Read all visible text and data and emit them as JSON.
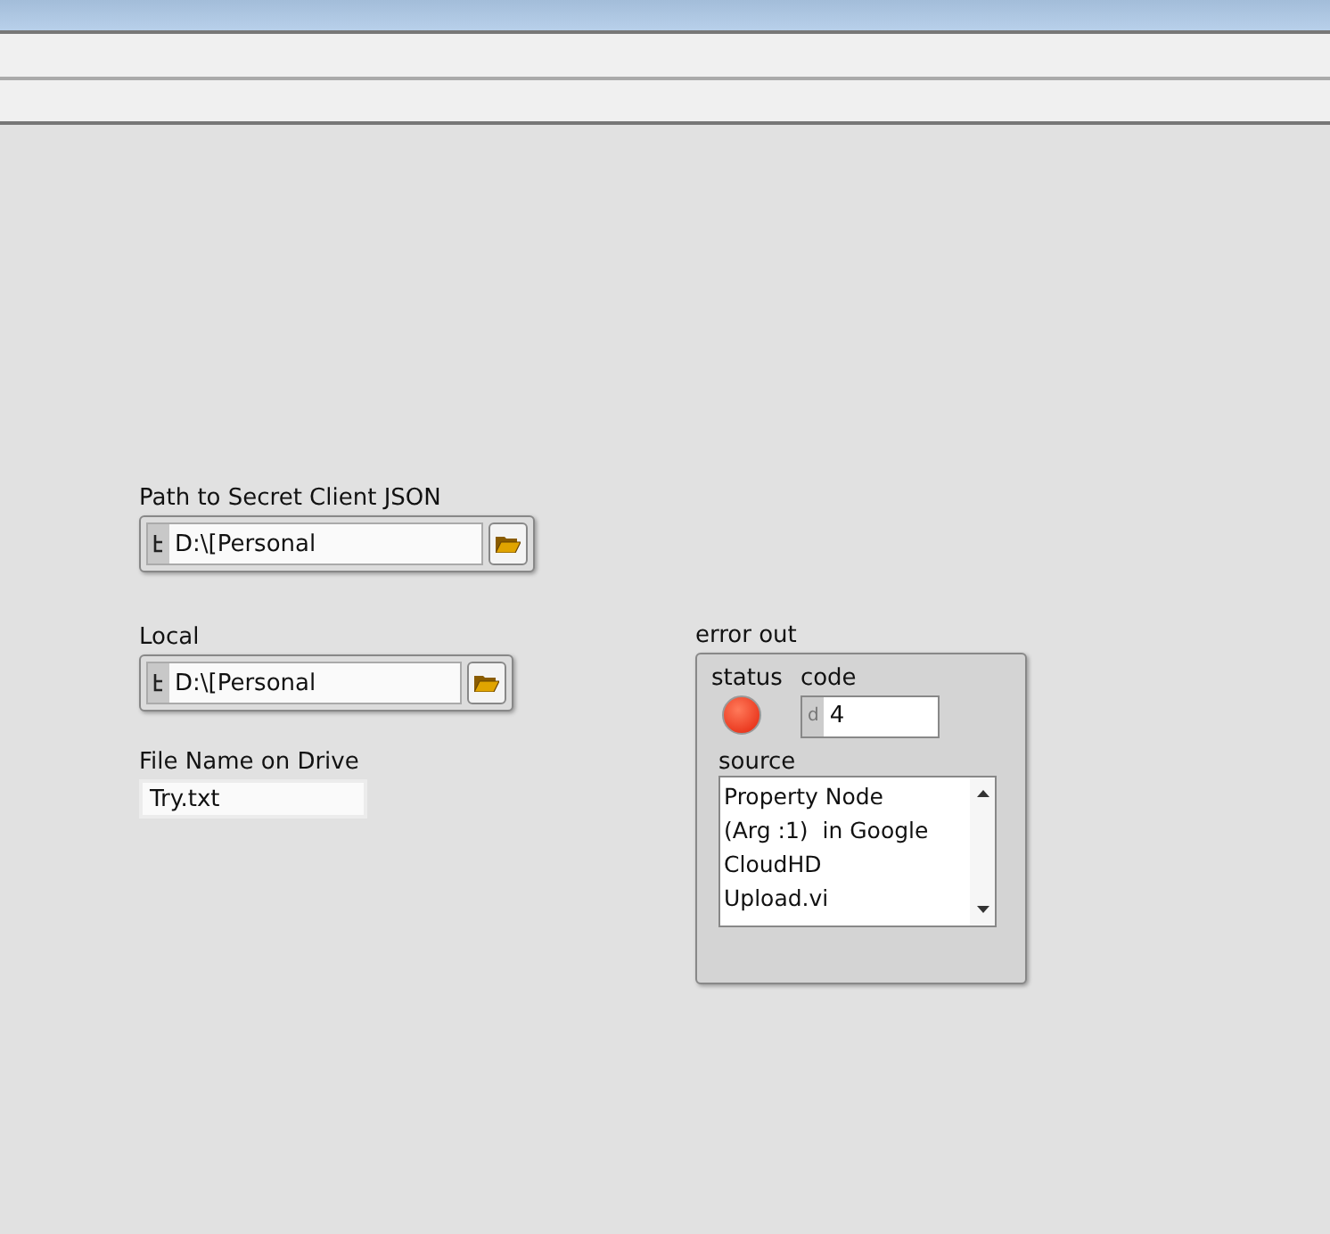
{
  "path_controls": [
    {
      "label": "Path to Secret Client JSON",
      "value": "D:\\[Personal"
    },
    {
      "label": "Local",
      "value": "D:\\[Personal"
    }
  ],
  "file_name": {
    "label": "File Name on Drive",
    "value": "Try.txt"
  },
  "error_out": {
    "label": "error out",
    "status_label": "status",
    "status": true,
    "code_label": "code",
    "radix": "d",
    "code": "4",
    "source_label": "source",
    "source": "Property Node\n(Arg :1)  in Google\nCloudHD\nUpload.vi"
  }
}
